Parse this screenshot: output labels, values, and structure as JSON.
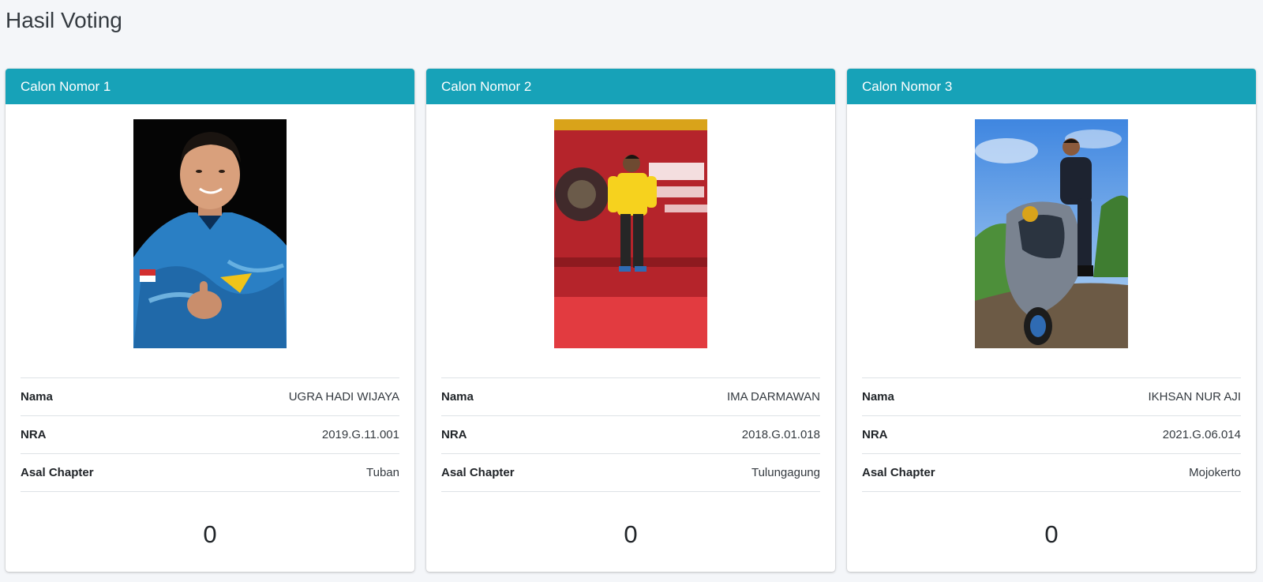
{
  "page": {
    "title": "Hasil Voting"
  },
  "labels": {
    "name": "Nama",
    "nra": "NRA",
    "chapter": "Asal Chapter"
  },
  "theme": {
    "header_color": "#17a2b8",
    "background": "#f4f6f9"
  },
  "candidates": [
    {
      "header": "Calon Nomor 1",
      "name": "UGRA HADI WIJAYA",
      "nra": "2019.G.11.001",
      "chapter": "Tuban",
      "votes": "0",
      "photo_icon": "candidate-photo"
    },
    {
      "header": "Calon Nomor 2",
      "name": "IMA DARMAWAN",
      "nra": "2018.G.01.018",
      "chapter": "Tulungagung",
      "votes": "0",
      "photo_icon": "candidate-photo"
    },
    {
      "header": "Calon Nomor 3",
      "name": "IKHSAN NUR AJI",
      "nra": "2021.G.06.014",
      "chapter": "Mojokerto",
      "votes": "0",
      "photo_icon": "candidate-photo"
    }
  ]
}
